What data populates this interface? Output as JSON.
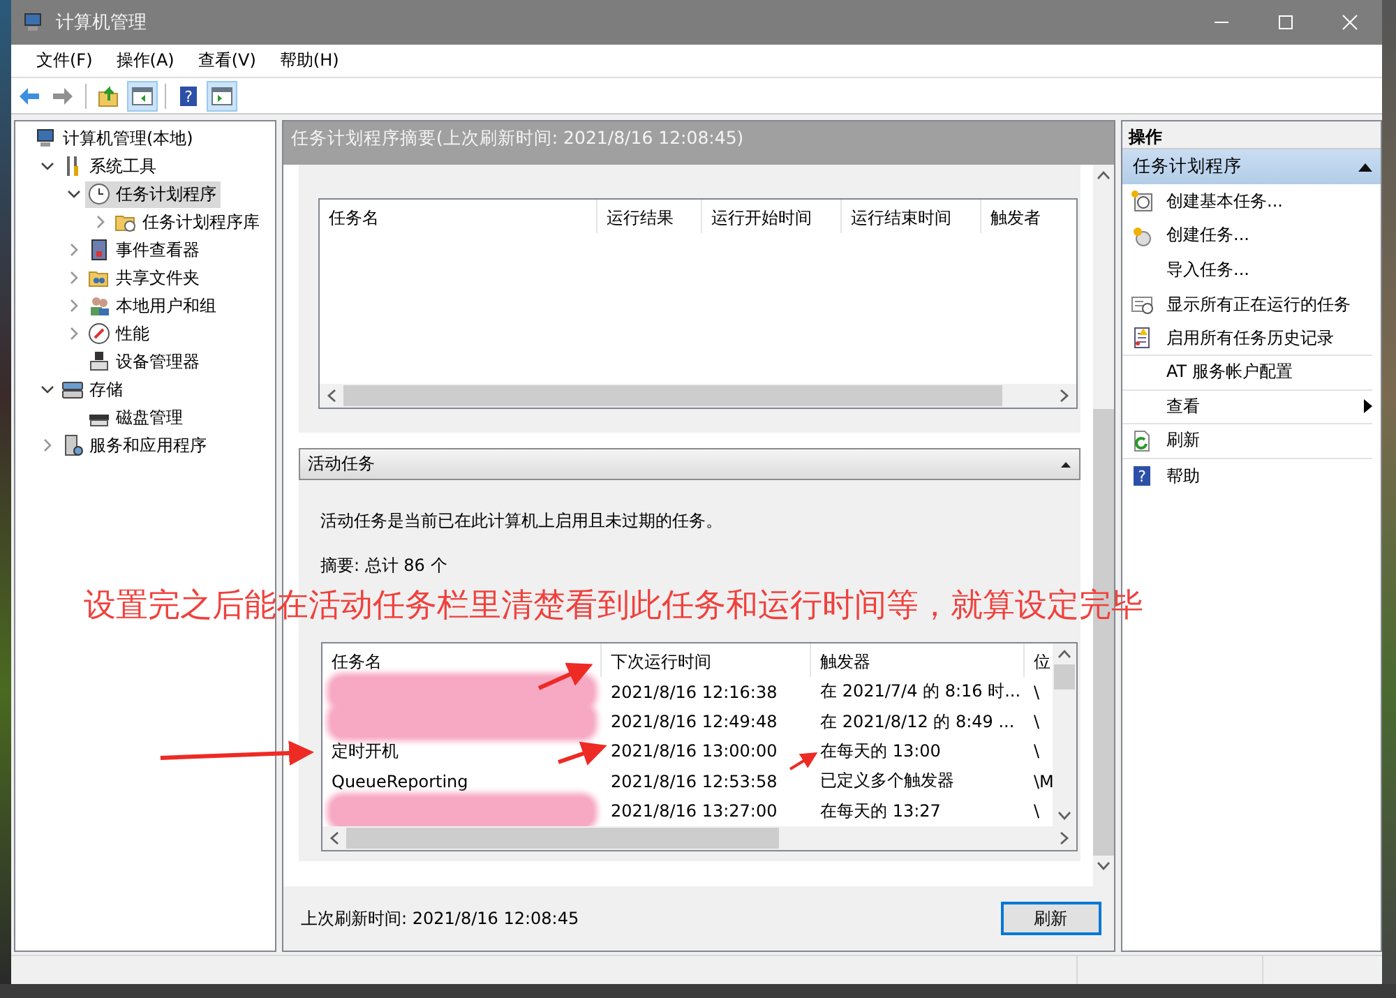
{
  "window": {
    "title": "计算机管理"
  },
  "menu": [
    {
      "label": "文件(F)"
    },
    {
      "label": "操作(A)"
    },
    {
      "label": "查看(V)"
    },
    {
      "label": "帮助(H)"
    }
  ],
  "toolbar": [
    {
      "kind": "back",
      "disabled": false
    },
    {
      "kind": "forward",
      "disabled": true
    },
    {
      "kind": "sep"
    },
    {
      "kind": "up",
      "disabled": false
    },
    {
      "kind": "tree",
      "on": true
    },
    {
      "kind": "sep"
    },
    {
      "kind": "help",
      "glyph": "?",
      "disabled": false
    },
    {
      "kind": "action",
      "on": true
    }
  ],
  "tree": [
    {
      "label": "计算机管理(本地)",
      "kind": "computer",
      "selected": false,
      "children": [
        {
          "label": "系统工具",
          "kind": "tools",
          "expanded": true,
          "selected": false,
          "children": [
            {
              "label": "任务计划程序",
              "kind": "clock",
              "expanded": true,
              "selected": true,
              "children": [
                {
                  "label": "任务计划程序库",
                  "kind": "folder",
                  "expanded": false,
                  "selected": false
                }
              ]
            },
            {
              "label": "事件查看器",
              "kind": "log",
              "expanded": false,
              "selected": false
            },
            {
              "label": "共享文件夹",
              "kind": "share",
              "expanded": false,
              "selected": false
            },
            {
              "label": "本地用户和组",
              "kind": "users",
              "expanded": false,
              "selected": false
            },
            {
              "label": "性能",
              "kind": "gauge",
              "expanded": false,
              "selected": false
            },
            {
              "label": "设备管理器",
              "kind": "device",
              "selected": false
            }
          ]
        },
        {
          "label": "存储",
          "kind": "storage",
          "expanded": true,
          "selected": false,
          "children": [
            {
              "label": "磁盘管理",
              "kind": "disk",
              "selected": false
            }
          ]
        },
        {
          "label": "服务和应用程序",
          "kind": "server",
          "expanded": false,
          "selected": false
        }
      ]
    }
  ],
  "summary_header": "任务计划程序摘要(上次刷新时间: 2021/8/16 12:08:45)",
  "status_table": {
    "columns": [
      "任务名",
      "运行结果",
      "运行开始时间",
      "运行结束时间",
      "触发者"
    ]
  },
  "active_tasks": {
    "title": "活动任务",
    "expanded": true,
    "description": "活动任务是当前已在此计算机上启用且未过期的任务。",
    "summary": "摘要: 总计 86 个",
    "columns": [
      "任务名",
      "下次运行时间",
      "触发器",
      "位"
    ],
    "rows": [
      {
        "redacted": true,
        "next_run": "2021/8/16 12:16:38",
        "trigger": "在 2021/7/4 的 8:16 时...",
        "location": "\\"
      },
      {
        "redacted": true,
        "next_run": "2021/8/16 12:49:48",
        "trigger": "在 2021/8/12 的 8:49 ...",
        "location": "\\"
      },
      {
        "redacted": false,
        "name": "定时开机",
        "next_run": "2021/8/16 13:00:00",
        "trigger": "在每天的 13:00",
        "location": "\\"
      },
      {
        "redacted": false,
        "name": "QueueReporting",
        "next_run": "2021/8/16 12:53:58",
        "trigger": "已定义多个触发器",
        "location": "\\M"
      },
      {
        "redacted": true,
        "next_run": "2021/8/16 13:27:00",
        "trigger": "在每天的 13:27",
        "location": "\\"
      }
    ]
  },
  "annotation": {
    "text": "设置完之后能在活动任务栏里清楚看到此任务和运行时间等，就算设定完毕"
  },
  "footer": {
    "refreshed": "上次刷新时间: 2021/8/16 12:08:45",
    "button": "刷新"
  },
  "actions": {
    "title": "操作",
    "section": {
      "title": "任务计划程序",
      "expanded": true
    },
    "items": [
      {
        "label": "创建基本任务...",
        "kind": "wizard",
        "separated": false
      },
      {
        "label": "创建任务...",
        "kind": "task",
        "separated": false
      },
      {
        "label": "导入任务...",
        "kind": "plain",
        "separated": false
      },
      {
        "label": "显示所有正在运行的任务",
        "kind": "list",
        "separated": false
      },
      {
        "label": "启用所有任务历史记录",
        "kind": "log",
        "separated": true
      },
      {
        "label": "AT 服务帐户配置",
        "kind": "plain",
        "separated": true
      },
      {
        "label": "查看",
        "kind": "submenu",
        "separated": true
      },
      {
        "label": "刷新",
        "kind": "refresh",
        "separated": true
      },
      {
        "label": "帮助",
        "kind": "help",
        "glyph": "?",
        "separated": false
      }
    ]
  }
}
